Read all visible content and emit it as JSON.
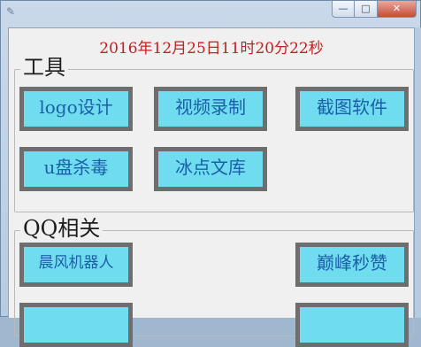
{
  "window": {
    "title": "",
    "app_icon": "app-icon",
    "minimize_glyph": "—",
    "maximize_glyph": "□",
    "close_glyph": "✕"
  },
  "clock": {
    "text": "2016年12月25日11时20分22秒",
    "color": "#c41f1f"
  },
  "groups": {
    "tools": {
      "title": "工具",
      "buttons": [
        "logo设计",
        "视频录制",
        "截图软件",
        "u盘杀毒",
        "冰点文库"
      ]
    },
    "qq": {
      "title": "QQ相关",
      "buttons": [
        "晨风机器人",
        "巅峰秒赞",
        "",
        ""
      ]
    }
  },
  "colors": {
    "button_fill": "#70dcf0",
    "button_border": "#6e6e6e",
    "button_text": "#1b5fa8"
  }
}
